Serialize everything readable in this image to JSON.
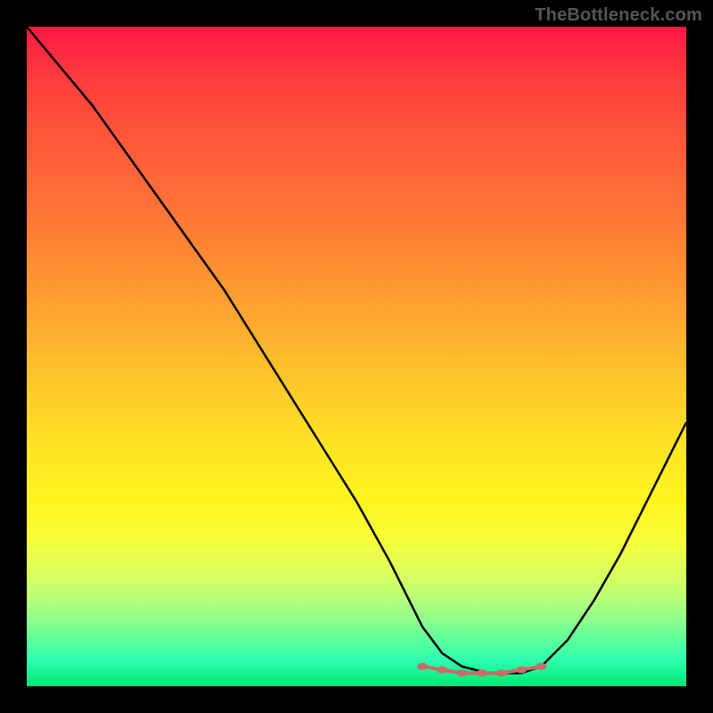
{
  "watermark": "TheBottleneck.com",
  "colors": {
    "frame": "#000000",
    "curve_stroke": "#000000",
    "marker_fill": "#cc6b66",
    "marker_stroke": "#cc6b66"
  },
  "chart_data": {
    "type": "line",
    "title": "",
    "xlabel": "",
    "ylabel": "",
    "xlim": [
      0,
      100
    ],
    "ylim": [
      0,
      100
    ],
    "grid": false,
    "legend": false,
    "series": [
      {
        "name": "bottleneck-curve",
        "x": [
          0,
          5,
          10,
          15,
          20,
          25,
          30,
          35,
          40,
          45,
          50,
          55,
          58,
          60,
          63,
          66,
          70,
          73,
          75,
          78,
          82,
          86,
          90,
          94,
          98,
          100
        ],
        "values": [
          100,
          94,
          88,
          81,
          74,
          67,
          60,
          52,
          44,
          36,
          28,
          19,
          13,
          9,
          5,
          3,
          2,
          2,
          2,
          3,
          7,
          13,
          20,
          28,
          36,
          40
        ]
      }
    ],
    "markers": {
      "name": "optimal-range",
      "x": [
        60,
        63,
        66,
        69,
        72,
        75,
        78
      ],
      "values": [
        3,
        2.5,
        2,
        2,
        2,
        2.5,
        3
      ]
    },
    "gradient_stops": [
      {
        "pos": 0,
        "color": "#ff1744"
      },
      {
        "pos": 50,
        "color": "#ffc72a"
      },
      {
        "pos": 75,
        "color": "#fff41e"
      },
      {
        "pos": 100,
        "color": "#00e676"
      }
    ]
  }
}
